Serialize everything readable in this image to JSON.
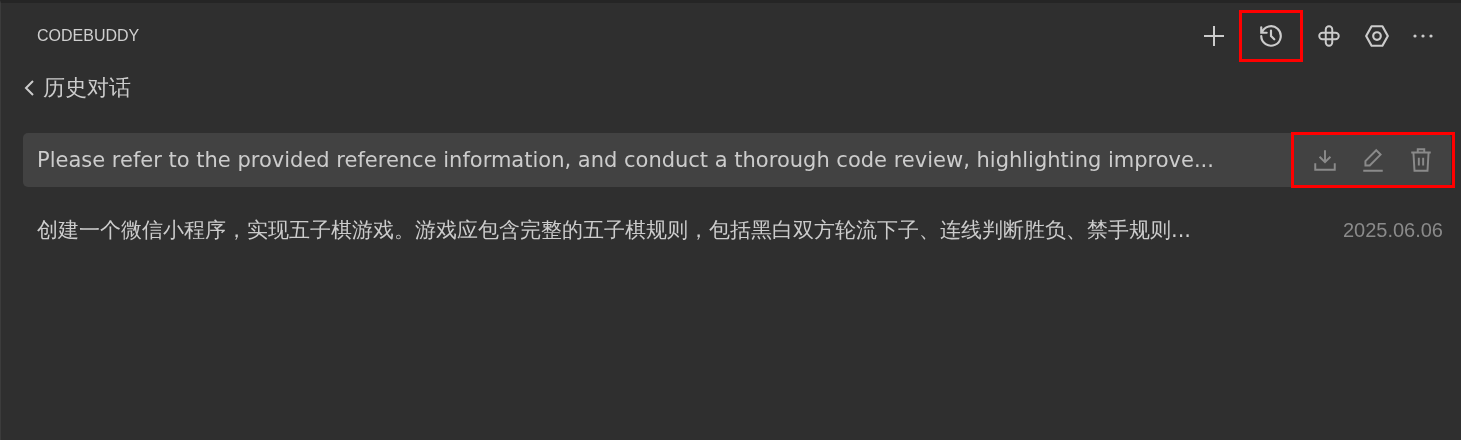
{
  "header": {
    "title": "CODEBUDDY",
    "toolbar": [
      {
        "kind": "plus",
        "highlighted": false
      },
      {
        "kind": "history",
        "highlighted": true
      },
      {
        "kind": "knot",
        "highlighted": false
      },
      {
        "kind": "settings",
        "highlighted": false
      },
      {
        "kind": "more",
        "highlighted": false
      }
    ]
  },
  "back": {
    "label": "历史对话"
  },
  "conversations": [
    {
      "title": "Please refer to the provided reference information, and conduct a thorough code review, highlighting improve...",
      "selected": true,
      "actions_highlighted": true
    },
    {
      "title": "创建一个微信小程序，实现五子棋游戏。游戏应包含完整的五子棋规则，包括黑白双方轮流下子、连线判断胜负、禁手规则...",
      "date": "2025.06.06",
      "selected": false
    }
  ]
}
